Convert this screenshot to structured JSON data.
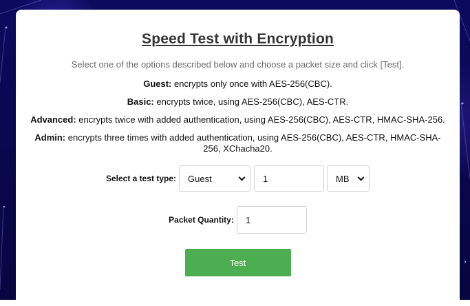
{
  "page": {
    "title": "Speed Test with Encryption",
    "subtitle": "Select one of the options described below and choose a packet size and click [Test]."
  },
  "options_info": [
    {
      "name": "Guest:",
      "text": " encrypts only once with AES-256(CBC)."
    },
    {
      "name": "Basic:",
      "text": " encrypts twice, using AES-256(CBC), AES-CTR."
    },
    {
      "name": "Advanced:",
      "text": " encrypts twice with added authentication, using AES-256(CBC), AES-CTR, HMAC-SHA-256."
    },
    {
      "name": "Admin:",
      "text": " encrypts three times with added authentication, using AES-256(CBC), AES-CTR, HMAC-SHA-256, XChacha20."
    }
  ],
  "form": {
    "test_type_label": "Select a test type:",
    "test_type_selected": "Guest",
    "packet_size_value": "1",
    "unit_selected": "MB",
    "packet_quantity_label": "Packet Quantity:",
    "packet_quantity_value": "1",
    "submit_label": "Test"
  },
  "colors": {
    "background": "#0a0850",
    "card": "#ffffff",
    "button": "#4cae50",
    "subtitle": "#6b6b6b"
  }
}
